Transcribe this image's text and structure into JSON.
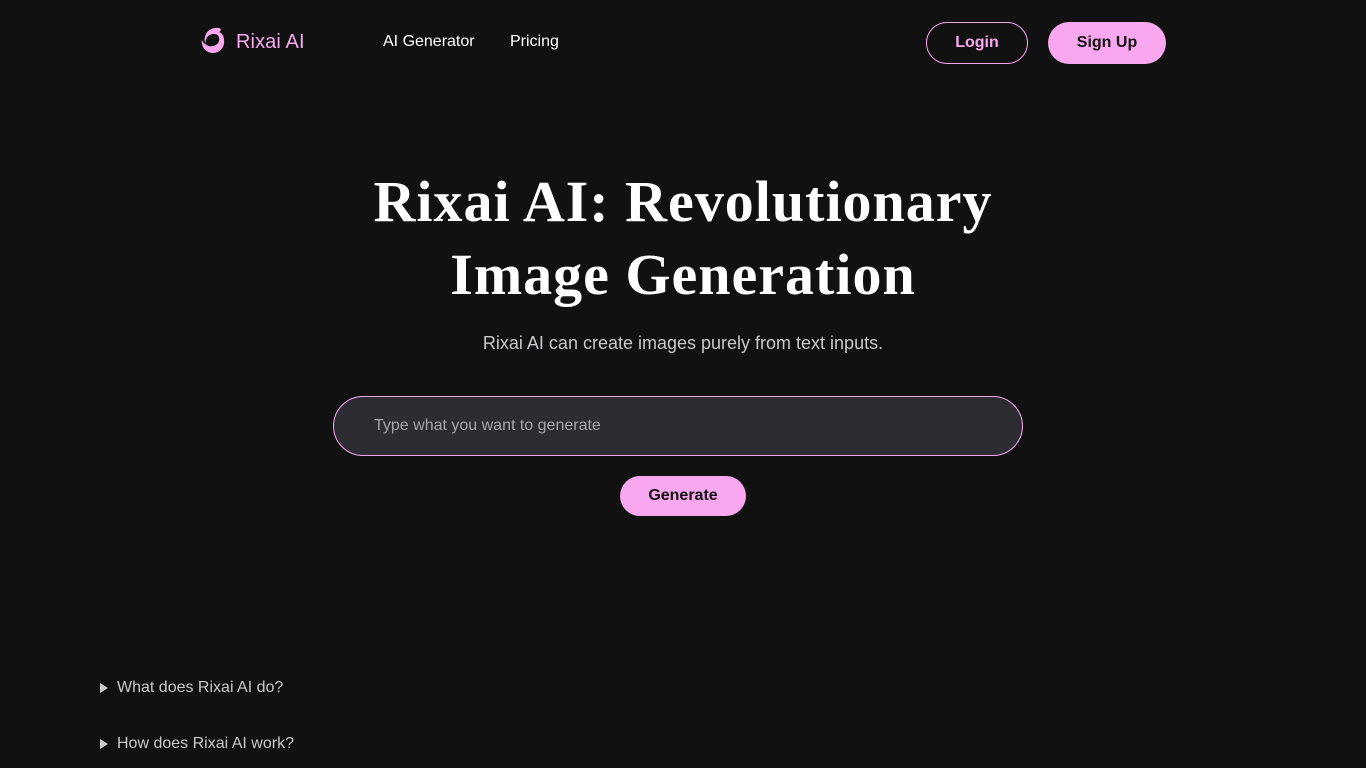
{
  "header": {
    "logo_text": "Rixai AI",
    "logo_icon": "dolphin-logo-icon",
    "nav": {
      "generator": "AI Generator",
      "pricing": "Pricing"
    },
    "login_label": "Login",
    "signup_label": "Sign Up"
  },
  "hero": {
    "title_line1": "Rixai AI: Revolutionary",
    "title_line2": "Image Generation",
    "subtitle": "Rixai AI can create images purely from text inputs.",
    "input_placeholder": "Type what you want to generate",
    "input_value": "",
    "generate_label": "Generate"
  },
  "faq": {
    "items": [
      {
        "question": "What does Rixai AI do?",
        "icon": "disclosure-triangle-icon"
      },
      {
        "question": "How does Rixai AI work?",
        "icon": "disclosure-triangle-icon"
      }
    ]
  },
  "colors": {
    "background": "#111112",
    "accent": "#f9a8f0",
    "input_background": "#2d2c33",
    "muted_text": "#c9c9cc"
  }
}
